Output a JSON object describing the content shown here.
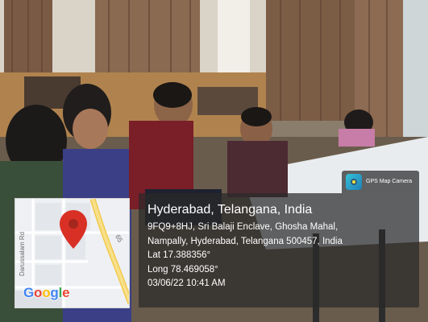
{
  "gps_badge": {
    "app_name": "GPS Map Camera",
    "logo_icon": "gps-map-camera-logo"
  },
  "location": {
    "title": "Hyderabad, Telangana, India",
    "address_line1": "9FQ9+8HJ, Sri Balaji Enclave, Ghosha Mahal,",
    "address_line2": "Nampally, Hyderabad, Telangana 500457, India",
    "latitude": "Lat 17.388356°",
    "longitude": "Long 78.469058°",
    "datetime": "03/06/22 10:41 AM"
  },
  "map": {
    "road_label": "Darussalam Rd",
    "road_number": "65",
    "brand": "Google",
    "pin_icon": "map-pin-icon",
    "colors": {
      "pin": "#d93025",
      "route": "#f6d25e",
      "google_blue": "#4285f4",
      "google_red": "#ea4335",
      "google_yellow": "#fbbc05",
      "google_green": "#34a853"
    }
  }
}
